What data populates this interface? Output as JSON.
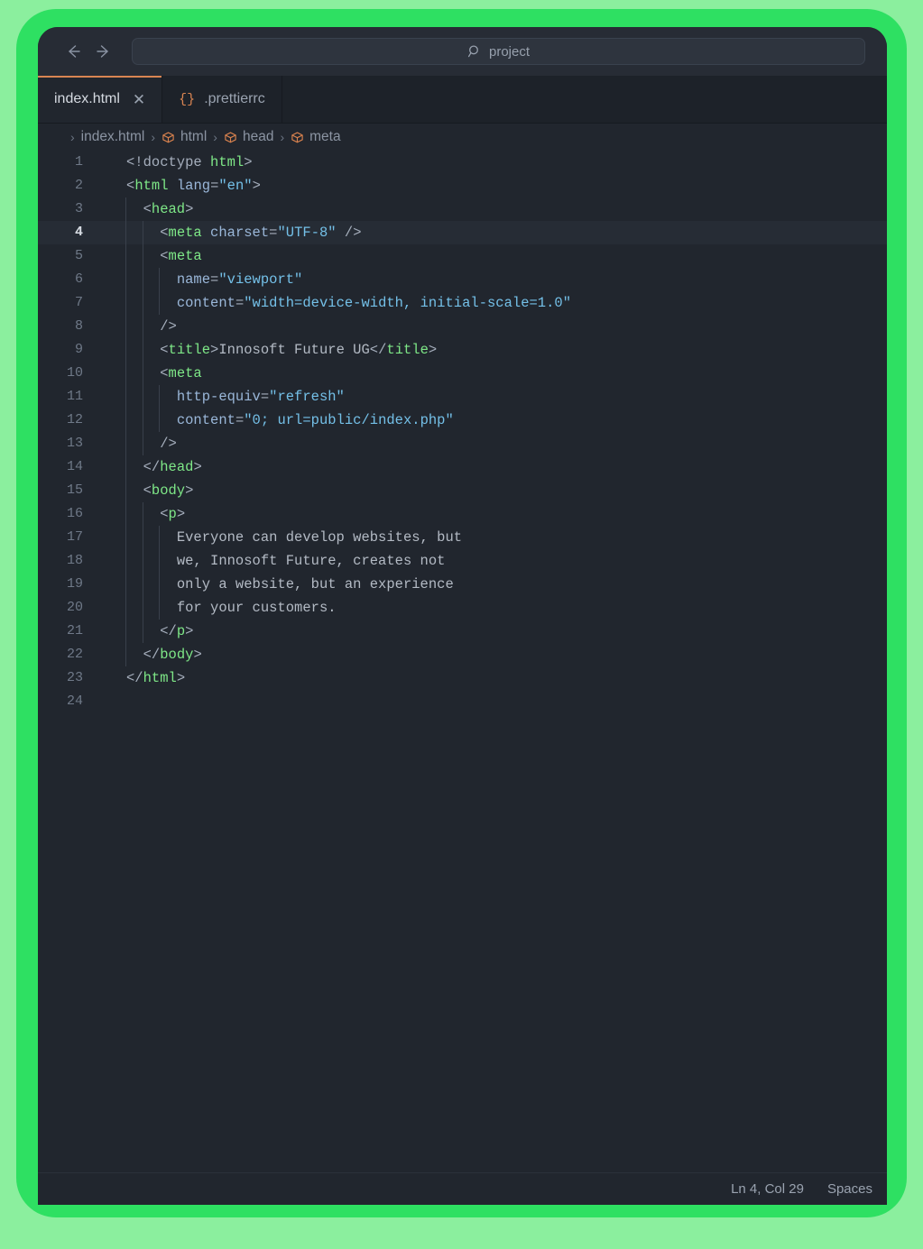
{
  "titlebar": {
    "back_label": "back-arrow",
    "forward_label": "forward-arrow",
    "search_value": "project",
    "search_placeholder": "Search"
  },
  "tabs": [
    {
      "label": "index.html",
      "icon": "",
      "close": "✕",
      "active": true
    },
    {
      "label": ".prettierrc",
      "icon": "{}",
      "close": "",
      "active": false
    }
  ],
  "breadcrumb": {
    "root_chevron": "›",
    "items": [
      {
        "label": "index.html",
        "icon": "none"
      },
      {
        "label": "html",
        "icon": "cube"
      },
      {
        "label": "head",
        "icon": "cube"
      },
      {
        "label": "meta",
        "icon": "cube"
      }
    ],
    "separator": "›"
  },
  "editor": {
    "active_line": 4,
    "total_lines": 24,
    "lines": [
      {
        "n": "1",
        "guides": 0,
        "tokens": [
          {
            "t": "punct",
            "v": "<!doctype "
          },
          {
            "t": "tag",
            "v": "html"
          },
          {
            "t": "punct",
            "v": ">"
          }
        ]
      },
      {
        "n": "2",
        "guides": 0,
        "tokens": [
          {
            "t": "punct",
            "v": "<"
          },
          {
            "t": "tag",
            "v": "html"
          },
          {
            "t": "punct",
            "v": " "
          },
          {
            "t": "attr",
            "v": "lang"
          },
          {
            "t": "punct",
            "v": "="
          },
          {
            "t": "val",
            "v": "\"en\""
          },
          {
            "t": "punct",
            "v": ">"
          }
        ]
      },
      {
        "n": "3",
        "guides": 1,
        "tokens": [
          {
            "t": "punct",
            "v": "  <"
          },
          {
            "t": "tag",
            "v": "head"
          },
          {
            "t": "punct",
            "v": ">"
          }
        ]
      },
      {
        "n": "4",
        "guides": 2,
        "tokens": [
          {
            "t": "punct",
            "v": "    <"
          },
          {
            "t": "tag",
            "v": "meta"
          },
          {
            "t": "punct",
            "v": " "
          },
          {
            "t": "attr",
            "v": "charset"
          },
          {
            "t": "punct",
            "v": "="
          },
          {
            "t": "val",
            "v": "\"UTF-8\""
          },
          {
            "t": "punct",
            "v": " />"
          }
        ]
      },
      {
        "n": "5",
        "guides": 2,
        "tokens": [
          {
            "t": "punct",
            "v": "    <"
          },
          {
            "t": "tag",
            "v": "meta"
          }
        ]
      },
      {
        "n": "6",
        "guides": 3,
        "tokens": [
          {
            "t": "punct",
            "v": "      "
          },
          {
            "t": "attr",
            "v": "name"
          },
          {
            "t": "punct",
            "v": "="
          },
          {
            "t": "val",
            "v": "\"viewport\""
          }
        ]
      },
      {
        "n": "7",
        "guides": 3,
        "tokens": [
          {
            "t": "punct",
            "v": "      "
          },
          {
            "t": "attr",
            "v": "content"
          },
          {
            "t": "punct",
            "v": "="
          },
          {
            "t": "val",
            "v": "\"width=device-width, initial-scale=1.0\""
          }
        ]
      },
      {
        "n": "8",
        "guides": 2,
        "tokens": [
          {
            "t": "punct",
            "v": "    />"
          }
        ]
      },
      {
        "n": "9",
        "guides": 2,
        "tokens": [
          {
            "t": "punct",
            "v": "    <"
          },
          {
            "t": "tag",
            "v": "title"
          },
          {
            "t": "punct",
            "v": ">"
          },
          {
            "t": "text",
            "v": "Innosoft Future UG"
          },
          {
            "t": "punct",
            "v": "</"
          },
          {
            "t": "tag",
            "v": "title"
          },
          {
            "t": "punct",
            "v": ">"
          }
        ]
      },
      {
        "n": "10",
        "guides": 2,
        "tokens": [
          {
            "t": "punct",
            "v": "    <"
          },
          {
            "t": "tag",
            "v": "meta"
          }
        ]
      },
      {
        "n": "11",
        "guides": 3,
        "tokens": [
          {
            "t": "punct",
            "v": "      "
          },
          {
            "t": "attr",
            "v": "http-equiv"
          },
          {
            "t": "punct",
            "v": "="
          },
          {
            "t": "val",
            "v": "\"refresh\""
          }
        ]
      },
      {
        "n": "12",
        "guides": 3,
        "tokens": [
          {
            "t": "punct",
            "v": "      "
          },
          {
            "t": "attr",
            "v": "content"
          },
          {
            "t": "punct",
            "v": "="
          },
          {
            "t": "val",
            "v": "\"0; url=public/index.php\""
          }
        ]
      },
      {
        "n": "13",
        "guides": 2,
        "tokens": [
          {
            "t": "punct",
            "v": "    />"
          }
        ]
      },
      {
        "n": "14",
        "guides": 1,
        "tokens": [
          {
            "t": "punct",
            "v": "  </"
          },
          {
            "t": "tag",
            "v": "head"
          },
          {
            "t": "punct",
            "v": ">"
          }
        ]
      },
      {
        "n": "15",
        "guides": 1,
        "tokens": [
          {
            "t": "punct",
            "v": "  <"
          },
          {
            "t": "tag",
            "v": "body"
          },
          {
            "t": "punct",
            "v": ">"
          }
        ]
      },
      {
        "n": "16",
        "guides": 2,
        "tokens": [
          {
            "t": "punct",
            "v": "    <"
          },
          {
            "t": "tag",
            "v": "p"
          },
          {
            "t": "punct",
            "v": ">"
          }
        ]
      },
      {
        "n": "17",
        "guides": 3,
        "tokens": [
          {
            "t": "punct",
            "v": "      "
          },
          {
            "t": "text",
            "v": "Everyone can develop websites, but"
          }
        ]
      },
      {
        "n": "18",
        "guides": 3,
        "tokens": [
          {
            "t": "punct",
            "v": "      "
          },
          {
            "t": "text",
            "v": "we, Innosoft Future, creates not"
          }
        ]
      },
      {
        "n": "19",
        "guides": 3,
        "tokens": [
          {
            "t": "punct",
            "v": "      "
          },
          {
            "t": "text",
            "v": "only a website, but an experience"
          }
        ]
      },
      {
        "n": "20",
        "guides": 3,
        "tokens": [
          {
            "t": "punct",
            "v": "      "
          },
          {
            "t": "text",
            "v": "for your customers."
          }
        ]
      },
      {
        "n": "21",
        "guides": 2,
        "tokens": [
          {
            "t": "punct",
            "v": "    </"
          },
          {
            "t": "tag",
            "v": "p"
          },
          {
            "t": "punct",
            "v": ">"
          }
        ]
      },
      {
        "n": "22",
        "guides": 1,
        "tokens": [
          {
            "t": "punct",
            "v": "  </"
          },
          {
            "t": "tag",
            "v": "body"
          },
          {
            "t": "punct",
            "v": ">"
          }
        ]
      },
      {
        "n": "23",
        "guides": 0,
        "tokens": [
          {
            "t": "punct",
            "v": "</"
          },
          {
            "t": "tag",
            "v": "html"
          },
          {
            "t": "punct",
            "v": ">"
          }
        ]
      },
      {
        "n": "24",
        "guides": 0,
        "tokens": []
      }
    ]
  },
  "statusbar": {
    "cursor_position": "Ln 4, Col 29",
    "indentation": "Spaces"
  },
  "colors": {
    "frame_outer": "#8bef9e",
    "frame_inner": "#2ee062",
    "editor_bg": "#21262e",
    "tab_active_accent": "#d98552",
    "tag": "#7ee787",
    "attr": "#9ab7d9",
    "value": "#74c0e8"
  }
}
